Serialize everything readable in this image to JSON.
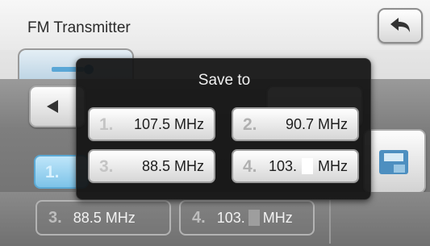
{
  "header": {
    "title": "FM Transmitter",
    "back_icon": "back-arrow-icon"
  },
  "tab": {
    "icon": "fm-transmitter-icon"
  },
  "background": {
    "left_arrow_icon": "arrow-left-icon",
    "preset1_num": "1.",
    "right_icon": "preset-save-icon",
    "bottom_presets": [
      {
        "num": "3.",
        "label": "88.5 MHz"
      },
      {
        "num": "4.",
        "prefix": "103.",
        "suffix": "MHz"
      }
    ]
  },
  "dialog": {
    "title": "Save to",
    "presets": [
      {
        "num": "1.",
        "label": "107.5 MHz"
      },
      {
        "num": "2.",
        "label": "90.7 MHz"
      },
      {
        "num": "3.",
        "label": "88.5 MHz"
      },
      {
        "num": "4.",
        "prefix": "103.",
        "suffix": "MHz"
      }
    ]
  },
  "colors": {
    "dialog_bg": "#121212",
    "active_preset": "#7dc3e8"
  }
}
